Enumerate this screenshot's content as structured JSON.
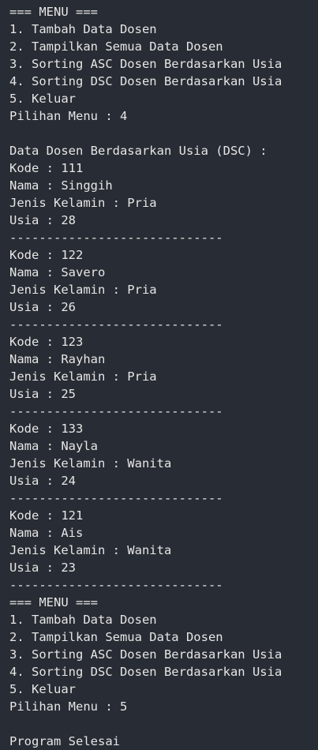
{
  "menu_1": {
    "header": "=== MENU ===",
    "items": [
      "1. Tambah Data Dosen",
      "2. Tampilkan Semua Data Dosen",
      "3. Sorting ASC Dosen Berdasarkan Usia",
      "4. Sorting DSC Dosen Berdasarkan Usia",
      "5. Keluar"
    ],
    "prompt": "Pilihan Menu : 4"
  },
  "result": {
    "title": "Data Dosen Berdasarkan Usia (DSC) :",
    "separator": "-----------------------------",
    "records": [
      {
        "kode": "Kode : 111",
        "nama": "Nama : Singgih",
        "jenis_kelamin": "Jenis Kelamin : Pria",
        "usia": "Usia : 28"
      },
      {
        "kode": "Kode : 122",
        "nama": "Nama : Savero",
        "jenis_kelamin": "Jenis Kelamin : Pria",
        "usia": "Usia : 26"
      },
      {
        "kode": "Kode : 123",
        "nama": "Nama : Rayhan",
        "jenis_kelamin": "Jenis Kelamin : Pria",
        "usia": "Usia : 25"
      },
      {
        "kode": "Kode : 133",
        "nama": "Nama : Nayla",
        "jenis_kelamin": "Jenis Kelamin : Wanita",
        "usia": "Usia : 24"
      },
      {
        "kode": "Kode : 121",
        "nama": "Nama : Ais",
        "jenis_kelamin": "Jenis Kelamin : Wanita",
        "usia": "Usia : 23"
      }
    ]
  },
  "menu_2": {
    "header": "=== MENU ===",
    "items": [
      "1. Tambah Data Dosen",
      "2. Tampilkan Semua Data Dosen",
      "3. Sorting ASC Dosen Berdasarkan Usia",
      "4. Sorting DSC Dosen Berdasarkan Usia",
      "5. Keluar"
    ],
    "prompt": "Pilihan Menu : 5"
  },
  "exit_message": "Program Selesai",
  "colors": {
    "background": "#282c34",
    "text": "#e6e6e6"
  }
}
